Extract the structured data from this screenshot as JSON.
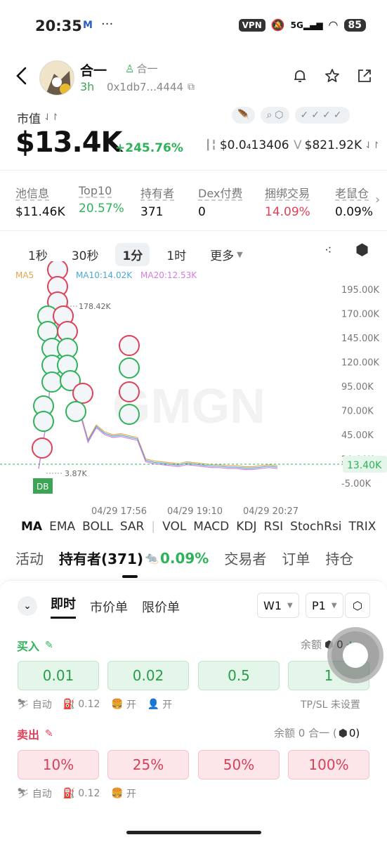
{
  "status_bar": {
    "time": "20:35",
    "vpn": "VPN",
    "net": "5G",
    "battery": "85"
  },
  "header": {
    "token_name": "合一",
    "token_sub": "合一",
    "age": "3h",
    "address": "0x1db7...4444"
  },
  "market": {
    "mcap_label": "市值",
    "mcap_value": "$13.4K",
    "mcap_change": "+245.76%",
    "price": "$0.0₄13406",
    "volume_prefix": "V",
    "volume": "$821.92K"
  },
  "stats": [
    {
      "label": "池信息",
      "value": "$11.46K",
      "tone": ""
    },
    {
      "label": "Top10",
      "value": "20.57%",
      "tone": "green"
    },
    {
      "label": "持有者",
      "value": "371",
      "tone": ""
    },
    {
      "label": "Dex付费",
      "value": "0",
      "tone": ""
    },
    {
      "label": "捆绑交易",
      "value": "14.09%",
      "tone": "red"
    },
    {
      "label": "老鼠仓",
      "value": "0.09%",
      "tone": ""
    }
  ],
  "timeframes": [
    "1秒",
    "30秒",
    "1分",
    "1时",
    "更多"
  ],
  "active_timeframe": "1分",
  "chart_data": {
    "type": "line",
    "ma_labels": {
      "ma5": "MA5",
      "ma10": "MA10:14.02K",
      "ma20": "MA20:12.53K"
    },
    "y_ticks": [
      "195.00K",
      "170.00K",
      "145.00K",
      "120.00K",
      "95.00K",
      "70.00K",
      "45.00K",
      "20.00K",
      "-5.00K"
    ],
    "x_ticks": [
      "04/29 17:56",
      "04/29 19:10",
      "04/29 20:27"
    ],
    "high_label": "178.42K",
    "low_label": "3.87K",
    "current": "13.40K",
    "marker": "DB",
    "ylim": [
      -5,
      195
    ],
    "series": [
      {
        "values": [
          10,
          60,
          150,
          178,
          120,
          70,
          40,
          55,
          48,
          45,
          46,
          44,
          42,
          20,
          18,
          17,
          16,
          15,
          17,
          16,
          15,
          14,
          14,
          13,
          13,
          12,
          12,
          13,
          14,
          13
        ]
      }
    ]
  },
  "indicators": [
    "MA",
    "EMA",
    "BOLL",
    "SAR",
    "VOL",
    "MACD",
    "KDJ",
    "RSI",
    "StochRsi",
    "TRIX"
  ],
  "tabs": {
    "activity": "活动",
    "holders": "持有者(371)",
    "holders_pct": "0.09%",
    "traders": "交易者",
    "orders": "订单",
    "positions": "持仓"
  },
  "order": {
    "tabs": [
      "即时",
      "市价单",
      "限价单"
    ],
    "wallet": "W1",
    "preset": "P1",
    "buy_label": "买入",
    "balance_label": "余额",
    "buy_balance": "0",
    "buy_amounts": [
      "0.01",
      "0.02",
      "0.5",
      "1"
    ],
    "buy_meta": {
      "auto": "自动",
      "gas": "0.12",
      "mev": "开",
      "user": "开",
      "tpsl": "TP/SL 未设置"
    },
    "sell_label": "卖出",
    "sell_balance": "余额 0 合一 (",
    "sell_balance_tail": "0)",
    "sell_amounts": [
      "10%",
      "25%",
      "50%",
      "100%"
    ],
    "sell_meta": {
      "auto": "自动",
      "gas": "0.12",
      "mev": "开"
    }
  },
  "colors": {
    "up": "#2fb35a",
    "down": "#e0405a",
    "ma10": "#4aa8d8",
    "ma20": "#d77be0",
    "ma5": "#e3a64a"
  }
}
